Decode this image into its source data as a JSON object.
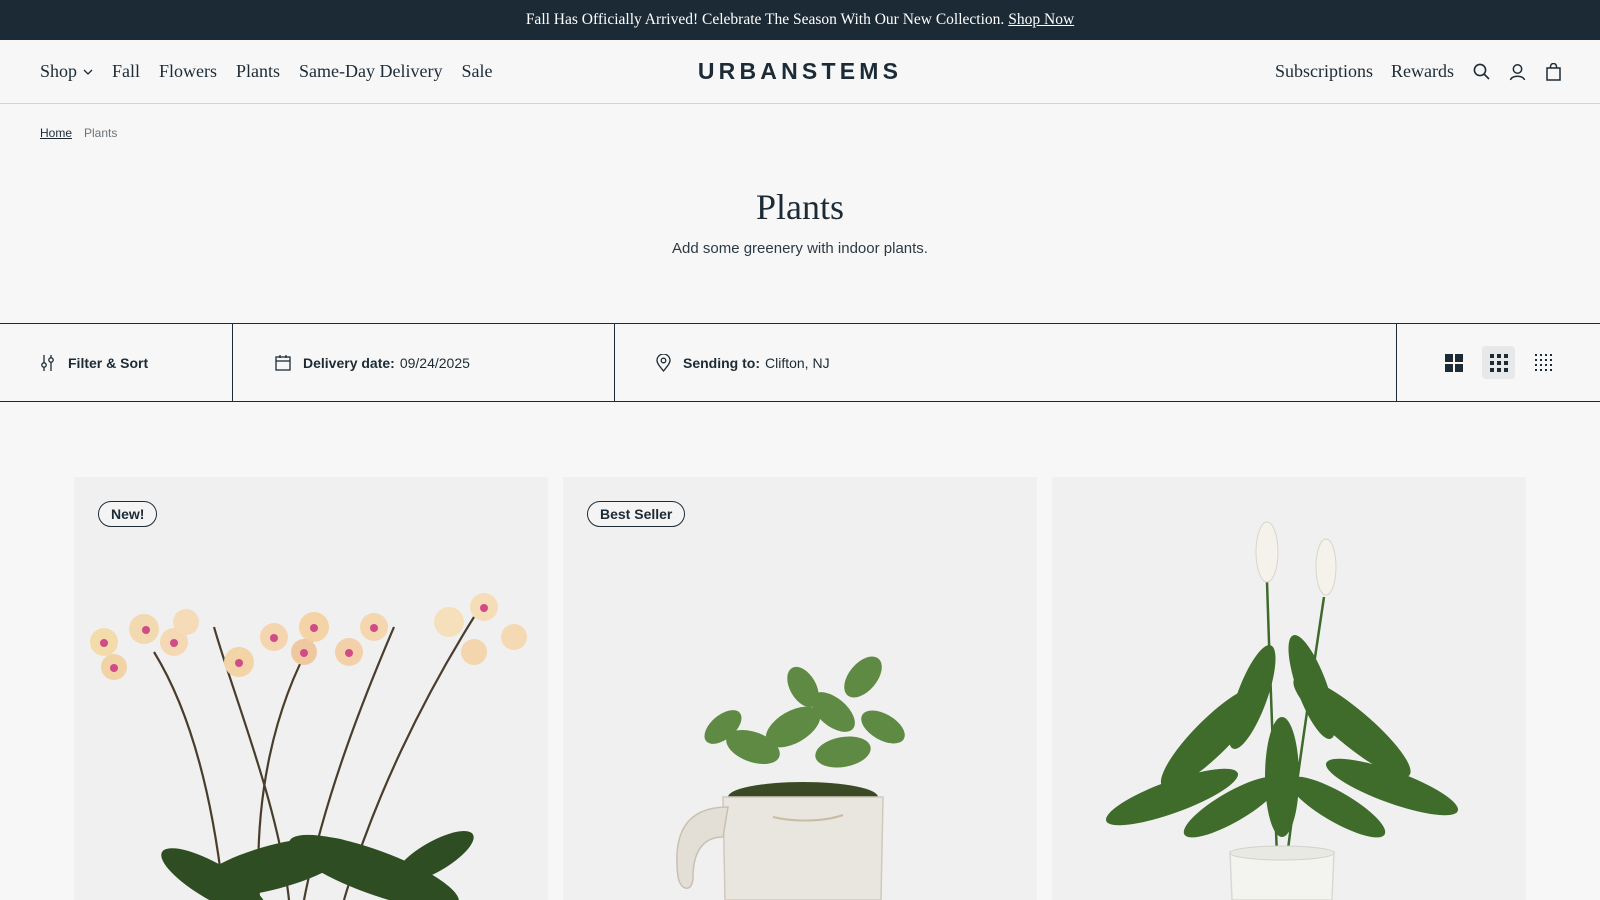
{
  "announcement": {
    "text": "Fall Has Officially Arrived! Celebrate The Season With Our New Collection.",
    "link": "Shop Now"
  },
  "nav": {
    "left": [
      "Shop",
      "Fall",
      "Flowers",
      "Plants",
      "Same-Day Delivery",
      "Sale"
    ],
    "logo": "URBANSTEMS",
    "right": [
      "Subscriptions",
      "Rewards"
    ],
    "icons": [
      "search-icon",
      "account-icon",
      "bag-icon"
    ]
  },
  "breadcrumb": {
    "home": "Home",
    "current": "Plants"
  },
  "hero": {
    "title": "Plants",
    "subtitle": "Add some greenery with indoor plants."
  },
  "filters": {
    "filter_sort": "Filter & Sort",
    "delivery_label": "Delivery date:",
    "delivery_value": "09/24/2025",
    "sending_label": "Sending to:",
    "sending_value": "Clifton, NJ",
    "view_options": [
      "large-grid",
      "medium-grid",
      "small-grid"
    ],
    "active_view": "medium-grid"
  },
  "products": [
    {
      "badge": "New!",
      "image": "orchid-plant"
    },
    {
      "badge": "Best Seller",
      "image": "succulent-elephant-planter"
    },
    {
      "badge": "",
      "image": "peace-lily-plant"
    }
  ],
  "colors": {
    "primary": "#1c2a35",
    "background": "#f7f7f7",
    "card": "#f0f0f0"
  }
}
